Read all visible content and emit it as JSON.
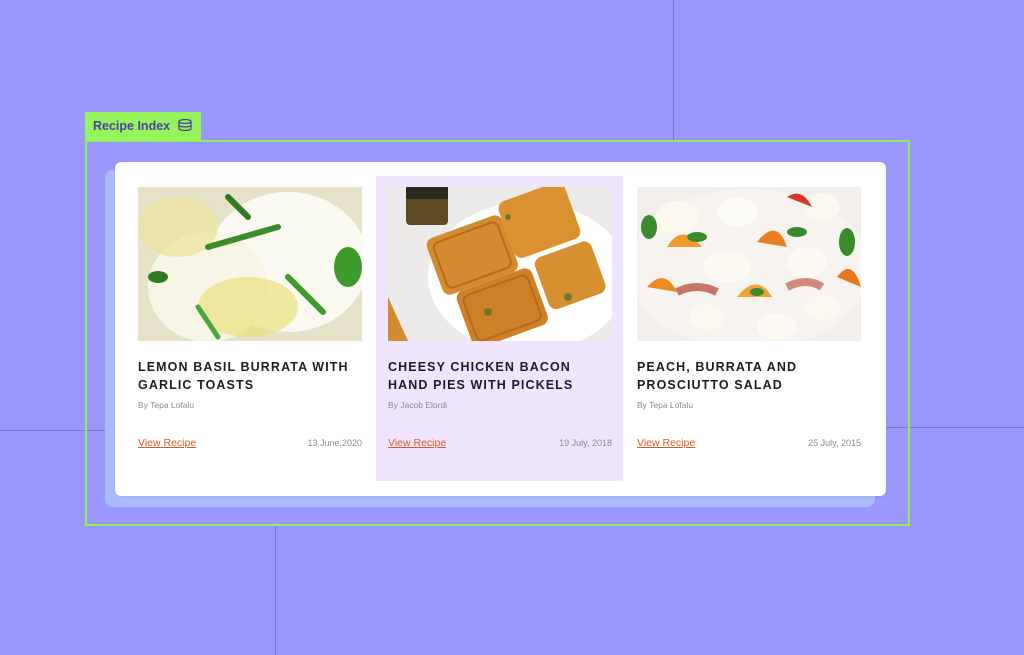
{
  "index_tag": {
    "label": "Recipe Index",
    "icon": "database-icon"
  },
  "recipes": [
    {
      "title": "Lemon Basil Burrata with Garlic Toasts",
      "author": "By Tepa Lofalu",
      "link": "View Recipe",
      "date": "13 June,2020"
    },
    {
      "title": "Cheesy Chicken Bacon Hand Pies with Pickels",
      "author": "By Jacob Elordi",
      "link": "View Recipe",
      "date": "19 July, 2018"
    },
    {
      "title": "Peach, Burrata and Prosciutto Salad",
      "author": "By Tepa Lofalu",
      "link": "View Recipe",
      "date": "25 July, 2015"
    }
  ],
  "colors": {
    "background": "#9a98fd",
    "tag_green": "#97f35a",
    "highlight": "#efe5ff",
    "link": "#e05a24"
  }
}
